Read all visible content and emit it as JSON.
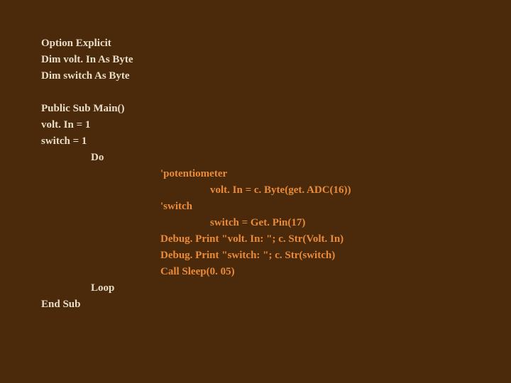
{
  "code": {
    "l1": "Option Explicit",
    "l2": "Dim volt. In As Byte",
    "l3": "Dim switch As Byte",
    "l4": "Public Sub Main()",
    "l5": "volt. In = 1",
    "l6": "switch = 1",
    "l7": "Do",
    "l8": "'potentiometer",
    "l9": "volt. In = c. Byte(get. ADC(16))",
    "l10": "'switch",
    "l11": "switch = Get. Pin(17)",
    "l12": "Debug. Print \"volt. In: \"; c. Str(Volt. In)",
    "l13": "Debug. Print \"switch: \"; c. Str(switch)",
    "l14": "Call Sleep(0. 05)",
    "l15": "Loop",
    "l16": "End Sub"
  }
}
